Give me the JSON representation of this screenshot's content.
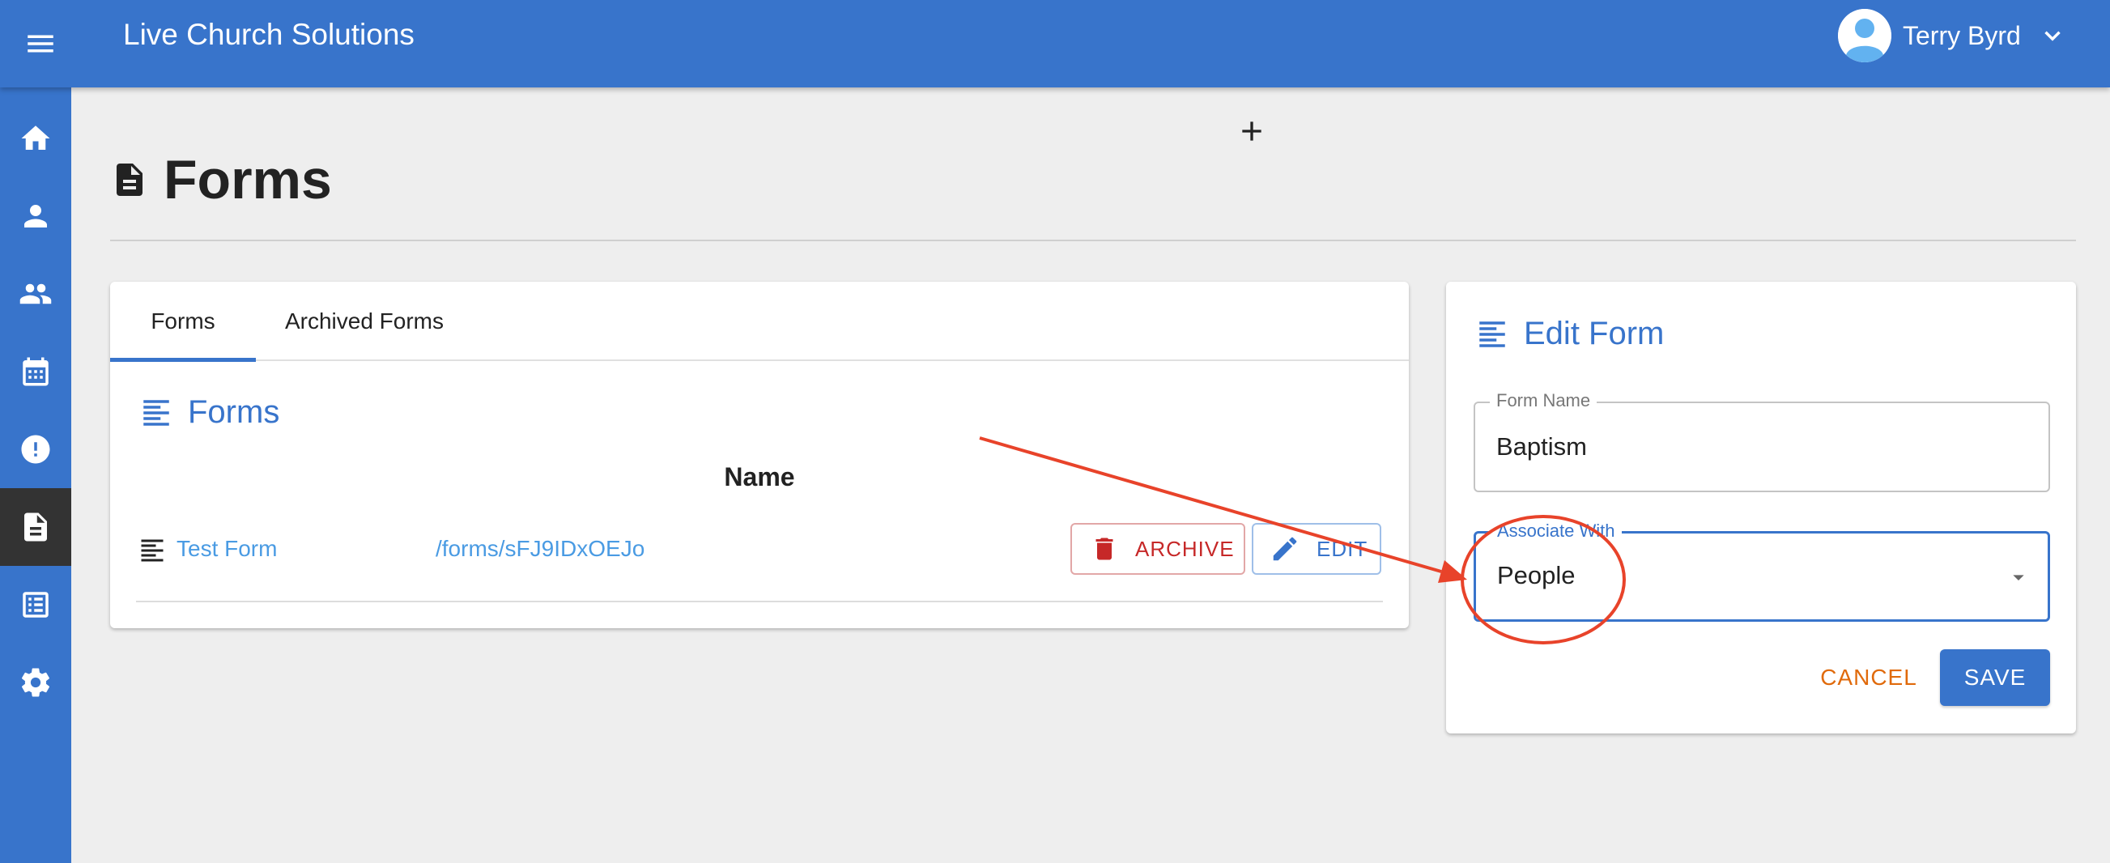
{
  "header": {
    "app_title": "Live Church Solutions",
    "user_name": "Terry Byrd"
  },
  "sidebar": {
    "items": [
      {
        "icon": "home-icon"
      },
      {
        "icon": "person-icon"
      },
      {
        "icon": "people-icon"
      },
      {
        "icon": "calendar-icon"
      },
      {
        "icon": "alert-icon"
      },
      {
        "icon": "document-icon",
        "active": true
      },
      {
        "icon": "list-icon"
      },
      {
        "icon": "gear-icon"
      }
    ]
  },
  "page": {
    "title": "Forms"
  },
  "forms_panel": {
    "tabs": [
      {
        "label": "Forms",
        "active": true
      },
      {
        "label": "Archived Forms"
      }
    ],
    "heading": "Forms",
    "column_header": "Name",
    "rows": [
      {
        "name": "Test Form",
        "path": "/forms/sFJ9IDxOEJo",
        "archive_label": "ARCHIVE",
        "edit_label": "EDIT"
      }
    ]
  },
  "edit_form": {
    "heading": "Edit Form",
    "form_name_label": "Form Name",
    "form_name_value": "Baptism",
    "associate_label": "Associate With",
    "associate_value": "People",
    "cancel_label": "CANCEL",
    "save_label": "SAVE"
  },
  "colors": {
    "primary": "#3874cb",
    "link": "#4a9be3",
    "archive": "#c62828",
    "cancel": "#e06a0b",
    "annotation": "#e8432a"
  }
}
